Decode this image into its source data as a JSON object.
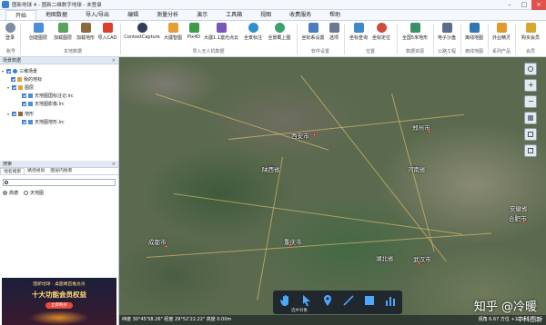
{
  "window": {
    "title": "图新地球 4 - 图新二维数字地球 - 未登录"
  },
  "menu": {
    "items": [
      "开始",
      "地图数据",
      "导入/导出",
      "编辑",
      "测量分析",
      "演示",
      "工具箱",
      "视图",
      "收费服务",
      "帮助"
    ]
  },
  "ribbon": {
    "buttons": [
      "登录",
      "创建图层",
      "加载图层",
      "加载地形",
      "导入CAD",
      "ContextCapture",
      "大疆智图",
      "Pix4D",
      "大疆1.1激光点云",
      "全景标注",
      "全景截上图",
      "坐标系设置",
      "选项",
      "坐标查询",
      "坐标定位",
      "全国5米地形",
      "电子沙盘",
      "离线地图",
      "外业精灵",
      "购买会员"
    ],
    "groups": [
      "账号",
      "本地数据",
      "导入无人机数据",
      "软件设置",
      "位置",
      "数据资源",
      "公路工程",
      "离线地图",
      "系列产品",
      "会员"
    ]
  },
  "scene_panel": {
    "title": "场景数据",
    "close": "×",
    "tree": [
      "三维场景",
      "我的地标",
      "图层",
      "天地图国标注记.lrc",
      "天地图影像.lrc",
      "地形",
      "天地图地形.lrc"
    ]
  },
  "search_panel": {
    "title": "搜索",
    "close": "×",
    "tabs": [
      "地名搜索",
      "路径规划",
      "图层内搜索"
    ],
    "input_value": "",
    "options": [
      "高德",
      "天地图"
    ]
  },
  "ad": {
    "top_text": "图新地球 · 桌面端首推会员",
    "main_text": "十大功能会员权益",
    "button_text": "立即购买"
  },
  "map": {
    "cities": [
      "西安市",
      "郑州市",
      "成都市",
      "重庆市",
      "武汉市",
      "合肥市"
    ],
    "provinces": [
      "陕西省",
      "河南省",
      "安徽省",
      "湖北省"
    ],
    "toolbar_label": "选中对象",
    "status_text": "纬度 30°45'58.26\" 经度 29°52'22.22\"  高度 0.00m",
    "status_right": "视角 6.67  方位 +12558.71 m",
    "watermark": "知乎 @冷暖",
    "watermark2": "中科图新"
  }
}
